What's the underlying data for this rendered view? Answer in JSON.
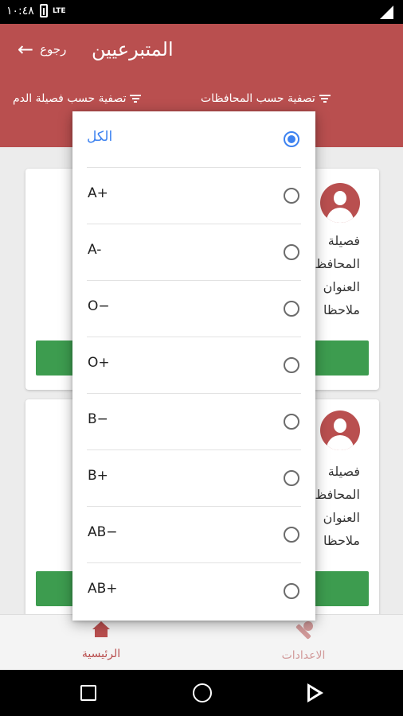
{
  "status_bar": {
    "time": "١٠:٤٨",
    "network": "LTE"
  },
  "header": {
    "title": "المتبرعيين",
    "back_label": "رجوع",
    "filter_blood_label": "تصفية حسب فصيلة الدم",
    "filter_gov_label": "تصفية حسب المحافظات"
  },
  "colors": {
    "primary": "#b94f4f",
    "accent": "#3d82f0",
    "button_green": "#3d9c4f"
  },
  "cards": [
    {
      "lines": [
        "فصيلة",
        "المحافظ",
        "العنوان",
        "ملاحظا"
      ]
    },
    {
      "lines": [
        "فصيلة",
        "المحافظ",
        "العنوان",
        "ملاحظا"
      ]
    }
  ],
  "popup": {
    "options": [
      {
        "label": "الكل",
        "selected": true
      },
      {
        "label": "A+",
        "selected": false
      },
      {
        "label": "A-",
        "selected": false
      },
      {
        "label": "O−",
        "selected": false
      },
      {
        "label": "O+",
        "selected": false
      },
      {
        "label": "B−",
        "selected": false
      },
      {
        "label": "B+",
        "selected": false
      },
      {
        "label": "AB−",
        "selected": false
      },
      {
        "label": "AB+",
        "selected": false
      }
    ]
  },
  "bottom_nav": {
    "home_label": "الرئيسية",
    "settings_label": "الاعدادات"
  }
}
